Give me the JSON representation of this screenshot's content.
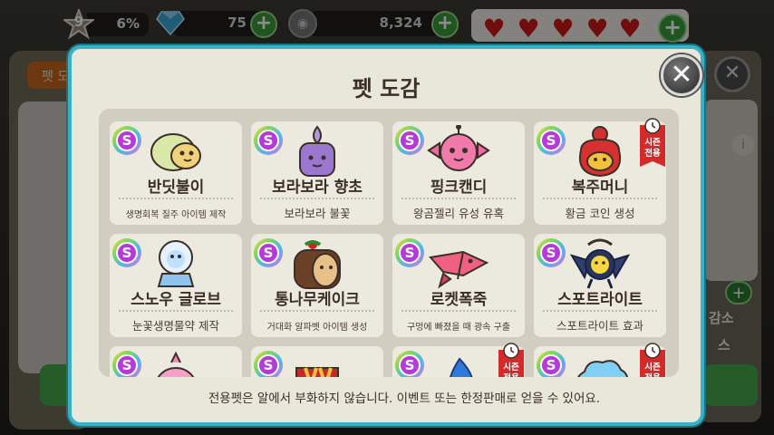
{
  "hud": {
    "level": "9",
    "level_percent": "6%",
    "gems": "75",
    "coins": "8,324",
    "hearts_count": 5,
    "plus_label": "+"
  },
  "background": {
    "left_tab": "펫 도",
    "right_text_1": "감소",
    "right_text_2": "스",
    "close_label": "✕",
    "info_label": "i"
  },
  "dialog": {
    "title": "펫 도감",
    "close_label": "✕",
    "footer_note": "전용펫은 알에서 부화하지 않습니다. 이벤트 또는 한정판매로 얻을 수 있어요."
  },
  "season_tag_label": [
    "시즌",
    "전용"
  ],
  "pets": [
    {
      "name": "반딧불이",
      "desc": "생명회복 질주 아이템 제작",
      "grade": "S",
      "season": false,
      "icon": "firefly-pet-icon"
    },
    {
      "name": "보라보라 향초",
      "desc": "보라보라 불꽃",
      "grade": "S",
      "season": false,
      "icon": "purple-candle-pet-icon"
    },
    {
      "name": "핑크캔디",
      "desc": "왕곰젤리 유성 유혹",
      "grade": "S",
      "season": false,
      "icon": "pink-candy-pet-icon"
    },
    {
      "name": "복주머니",
      "desc": "황금 코인 생성",
      "grade": "S",
      "season": true,
      "icon": "lucky-pouch-pet-icon"
    },
    {
      "name": "스노우 글로브",
      "desc": "눈꽃생명물약 제작",
      "grade": "S",
      "season": false,
      "icon": "snow-globe-pet-icon"
    },
    {
      "name": "통나무케이크",
      "desc": "거대화 알파벳 아이템 생성",
      "grade": "S",
      "season": false,
      "icon": "log-cake-pet-icon"
    },
    {
      "name": "로켓폭죽",
      "desc": "구멍에 빠졌을 때 광속 구출",
      "grade": "S",
      "season": false,
      "icon": "rocket-firecracker-pet-icon"
    },
    {
      "name": "스포트라이트",
      "desc": "스포트라이트 효과",
      "grade": "S",
      "season": false,
      "icon": "spotlight-pet-icon"
    },
    {
      "name": "",
      "desc": "",
      "grade": "S",
      "season": false,
      "icon": "pink-blob-pet-icon"
    },
    {
      "name": "",
      "desc": "",
      "grade": "S",
      "season": false,
      "icon": "red-book-pet-icon"
    },
    {
      "name": "",
      "desc": "",
      "grade": "S",
      "season": true,
      "icon": "blue-flame-pet-icon"
    },
    {
      "name": "",
      "desc": "",
      "grade": "S",
      "season": true,
      "icon": "cloud-pet-icon"
    }
  ],
  "colors": {
    "dialog_border": "#36b2c7",
    "dialog_bg": "#e9e6da",
    "heart": "#d01818",
    "plus_green": "#3a9d3a",
    "season_red": "#d42a2a"
  }
}
